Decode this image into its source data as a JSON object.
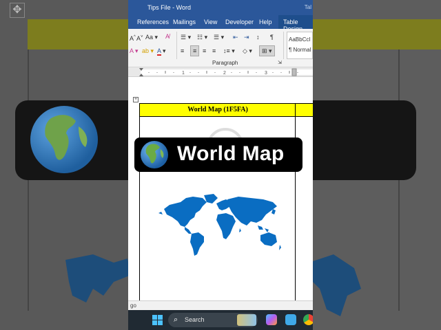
{
  "window": {
    "title": "Tips File  -  Word",
    "title_right": "Tal"
  },
  "menu": {
    "items": [
      "References",
      "Mailings",
      "View",
      "Developer",
      "Help",
      "Table Design"
    ]
  },
  "ribbon": {
    "font_size_button": "Aa",
    "paragraph_group_label": "Paragraph",
    "styles_sample": "AaBbCcI",
    "styles_normal": "¶ Normal"
  },
  "table": {
    "header_text": "World Map (1F5FA)"
  },
  "caption": {
    "text": "World Map"
  },
  "statusbar": {
    "text": "go"
  },
  "taskbar": {
    "search_placeholder": "Search"
  },
  "colors": {
    "word_blue": "#2b579a",
    "table_header_fill": "#ffff00",
    "map_blue": "#0a6dc2",
    "taskbar_bg": "#202a33"
  }
}
